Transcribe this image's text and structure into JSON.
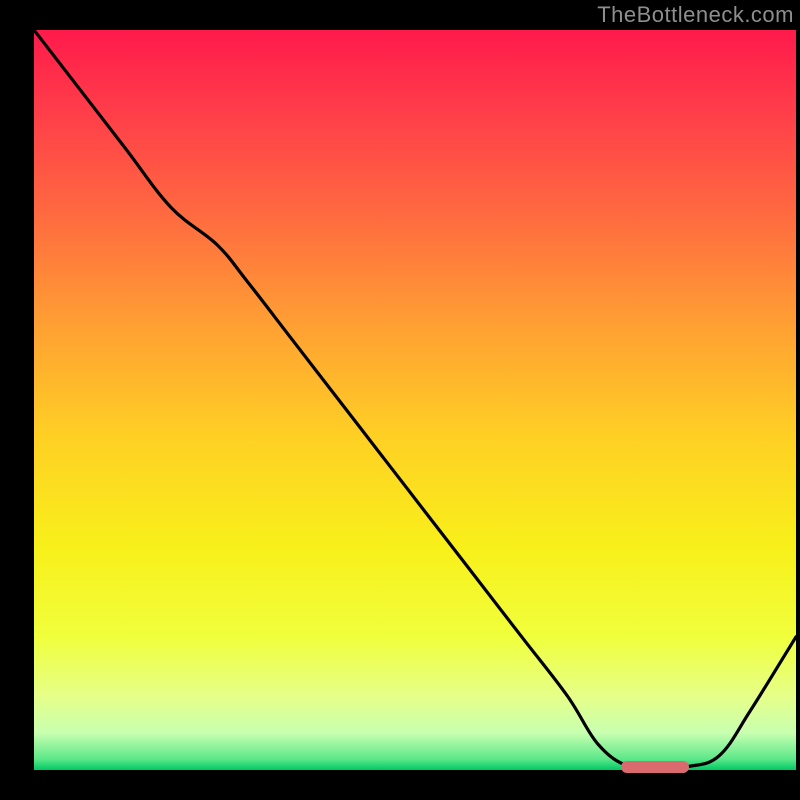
{
  "watermark": "TheBottleneck.com",
  "chart_data": {
    "type": "line",
    "title": "",
    "xlabel": "",
    "ylabel": "",
    "xlim": [
      0,
      100
    ],
    "ylim": [
      0,
      100
    ],
    "grid": false,
    "background": "red-yellow-green vertical gradient",
    "series": [
      {
        "name": "bottleneck-curve",
        "x": [
          0,
          6,
          12,
          18,
          24,
          28,
          34,
          40,
          46,
          52,
          58,
          64,
          70,
          74,
          78,
          82,
          86,
          90,
          94,
          100
        ],
        "y": [
          100,
          92,
          84,
          76,
          71,
          66,
          58,
          50,
          42,
          34,
          26,
          18,
          10,
          3.5,
          0.5,
          0.5,
          0.5,
          2,
          8,
          18
        ]
      }
    ],
    "optimal_marker": {
      "x_start": 77,
      "x_end": 86,
      "y": 0.6,
      "color": "#db6a6f"
    },
    "gradient_stops": [
      {
        "pos": 0.0,
        "color": "#ff1a4b"
      },
      {
        "pos": 0.1,
        "color": "#ff3a4a"
      },
      {
        "pos": 0.25,
        "color": "#ff6a40"
      },
      {
        "pos": 0.4,
        "color": "#ffa033"
      },
      {
        "pos": 0.55,
        "color": "#ffd024"
      },
      {
        "pos": 0.7,
        "color": "#f8f01a"
      },
      {
        "pos": 0.82,
        "color": "#f0ff3c"
      },
      {
        "pos": 0.9,
        "color": "#e6ff88"
      },
      {
        "pos": 0.95,
        "color": "#c8ffb0"
      },
      {
        "pos": 0.985,
        "color": "#5de88a"
      },
      {
        "pos": 1.0,
        "color": "#00c864"
      }
    ]
  }
}
